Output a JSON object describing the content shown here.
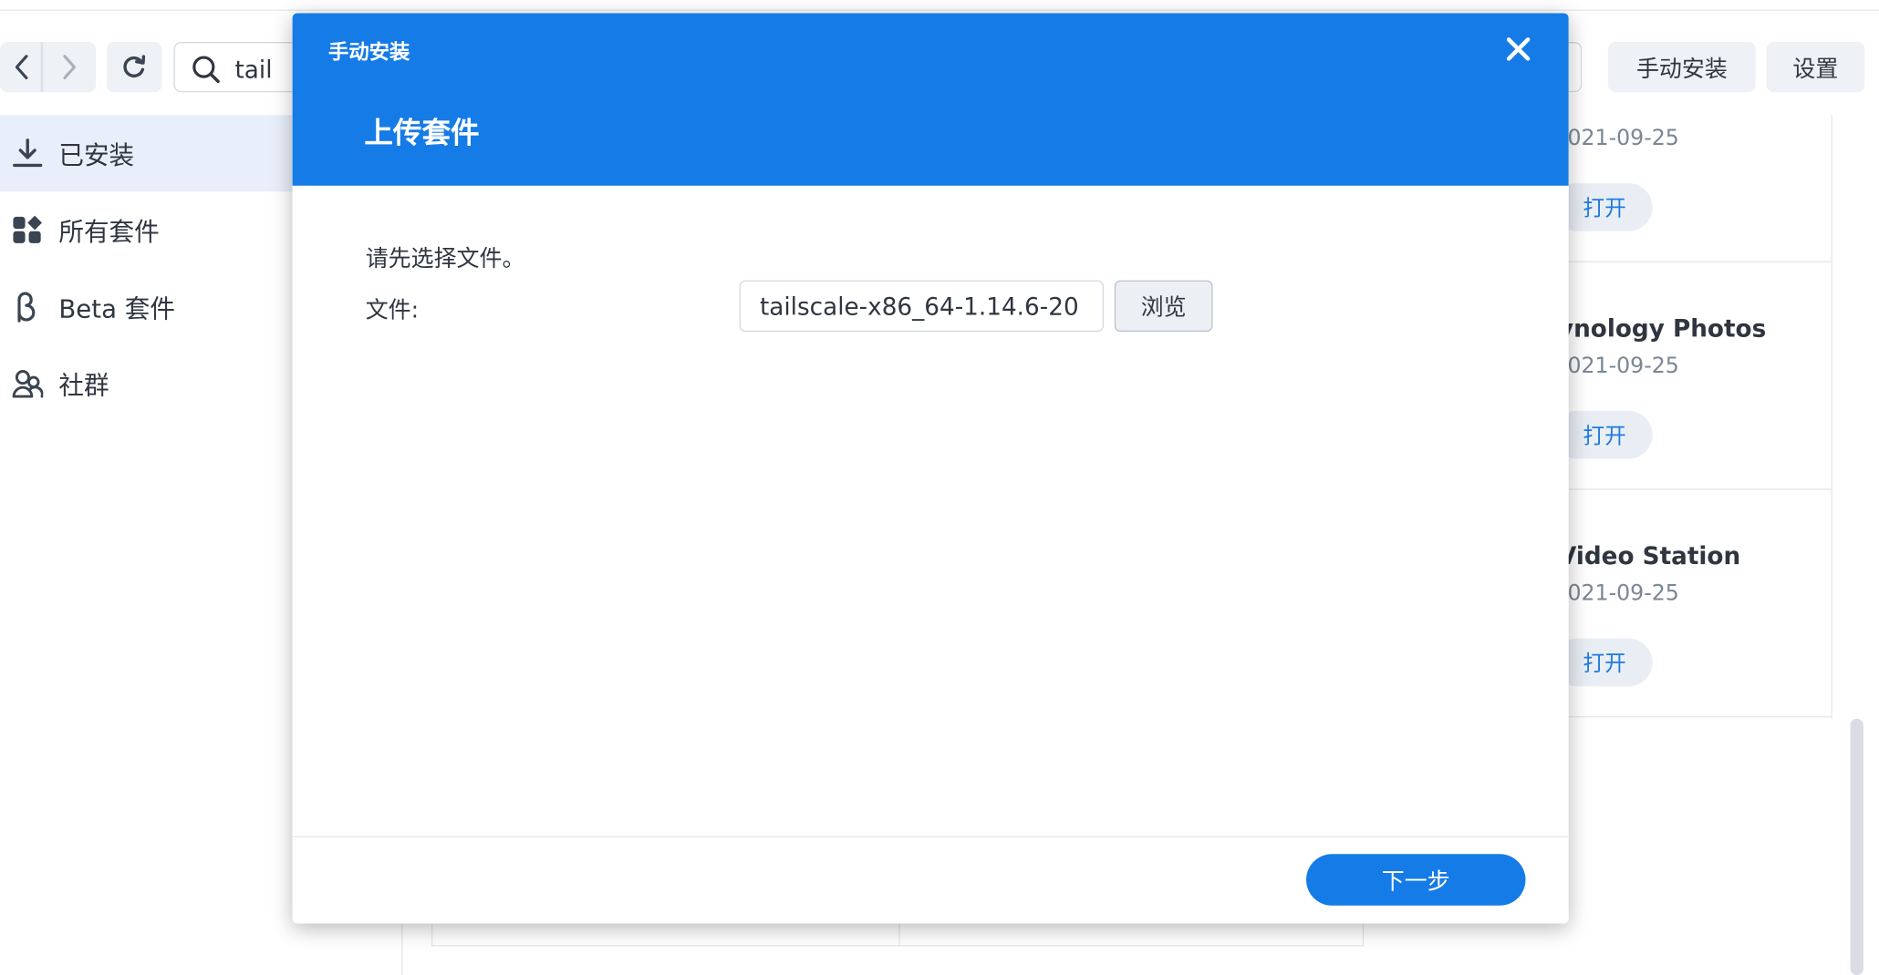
{
  "toolbar": {
    "search_value": "tail",
    "manual_install_label": "手动安装",
    "settings_label": "设置"
  },
  "sidebar": {
    "items": [
      {
        "label": "已安装",
        "icon": "download-icon",
        "active": true
      },
      {
        "label": "所有套件",
        "icon": "grid-icon",
        "active": false
      },
      {
        "label": "Beta 套件",
        "icon": "beta-icon",
        "active": false
      },
      {
        "label": "社群",
        "icon": "community-icon",
        "active": false
      }
    ]
  },
  "packages": [
    {
      "name": "",
      "date": "021-09-25",
      "open_label": "打开"
    },
    {
      "name": "ynology Photos",
      "date": "021-09-25",
      "open_label": "打开"
    },
    {
      "name": "Video Station",
      "date": "021-09-25",
      "open_label": "打开"
    }
  ],
  "modal": {
    "window_title": "手动安装",
    "heading": "上传套件",
    "instruction": "请先选择文件。",
    "file_label": "文件:",
    "file_value": "tailscale-x86_64-1.14.6-20",
    "browse_label": "浏览",
    "next_label": "下一步"
  },
  "colors": {
    "accent": "#157be6",
    "sidebar_active": "#e9effa",
    "button_bg": "#eef1f5",
    "text": "#2f3640",
    "muted": "#7b8794"
  }
}
